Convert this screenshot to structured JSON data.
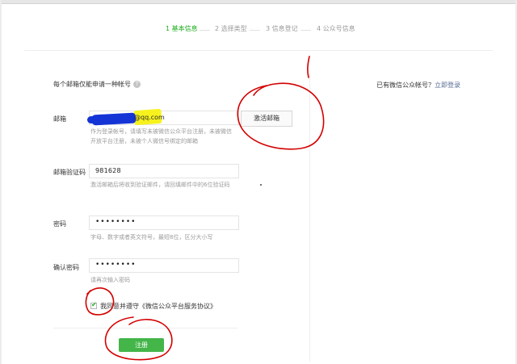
{
  "steps": [
    {
      "label": "1 基本信息",
      "active": true
    },
    {
      "label": "2 选择类型",
      "active": false
    },
    {
      "label": "3 信息登记",
      "active": false
    },
    {
      "label": "4 公众号信息",
      "active": false
    }
  ],
  "form": {
    "note": "每个邮箱仅能申请一种帐号",
    "email": {
      "label": "邮箱",
      "value_suffix": "@qq.com",
      "hint": "作为登录帐号，请填写未被微信公众平台注册，未被微信开放平台注册，未被个人微信号绑定的邮箱",
      "activate_label": "激活邮箱"
    },
    "code": {
      "label": "邮箱验证码",
      "value": "981628",
      "hint": "激活邮箱后将收到验证邮件，请回填邮件中的6位验证码"
    },
    "password": {
      "label": "密码",
      "value": "••••••••",
      "hint": "字母、数字或者英文符号，最短8位，区分大小写"
    },
    "confirm": {
      "label": "确认密码",
      "value": "••••••••",
      "hint": "请再次输入密码"
    },
    "agreement": {
      "checked": true,
      "check_glyph": "✔",
      "label": "我同意并遵守《微信公众平台服务协议》"
    },
    "register_label": "注册"
  },
  "side": {
    "hint": "已有微信公众帐号？",
    "login_link": "立即登录"
  },
  "icons": {
    "help": "?",
    "help_icon_name": "help-circle-icon"
  },
  "colors": {
    "accent": "#1aad19",
    "button": "#44b549",
    "link": "#576b95",
    "annotation": "#d40000",
    "redaction": "#1434d6",
    "highlight": "#f7f21d"
  }
}
